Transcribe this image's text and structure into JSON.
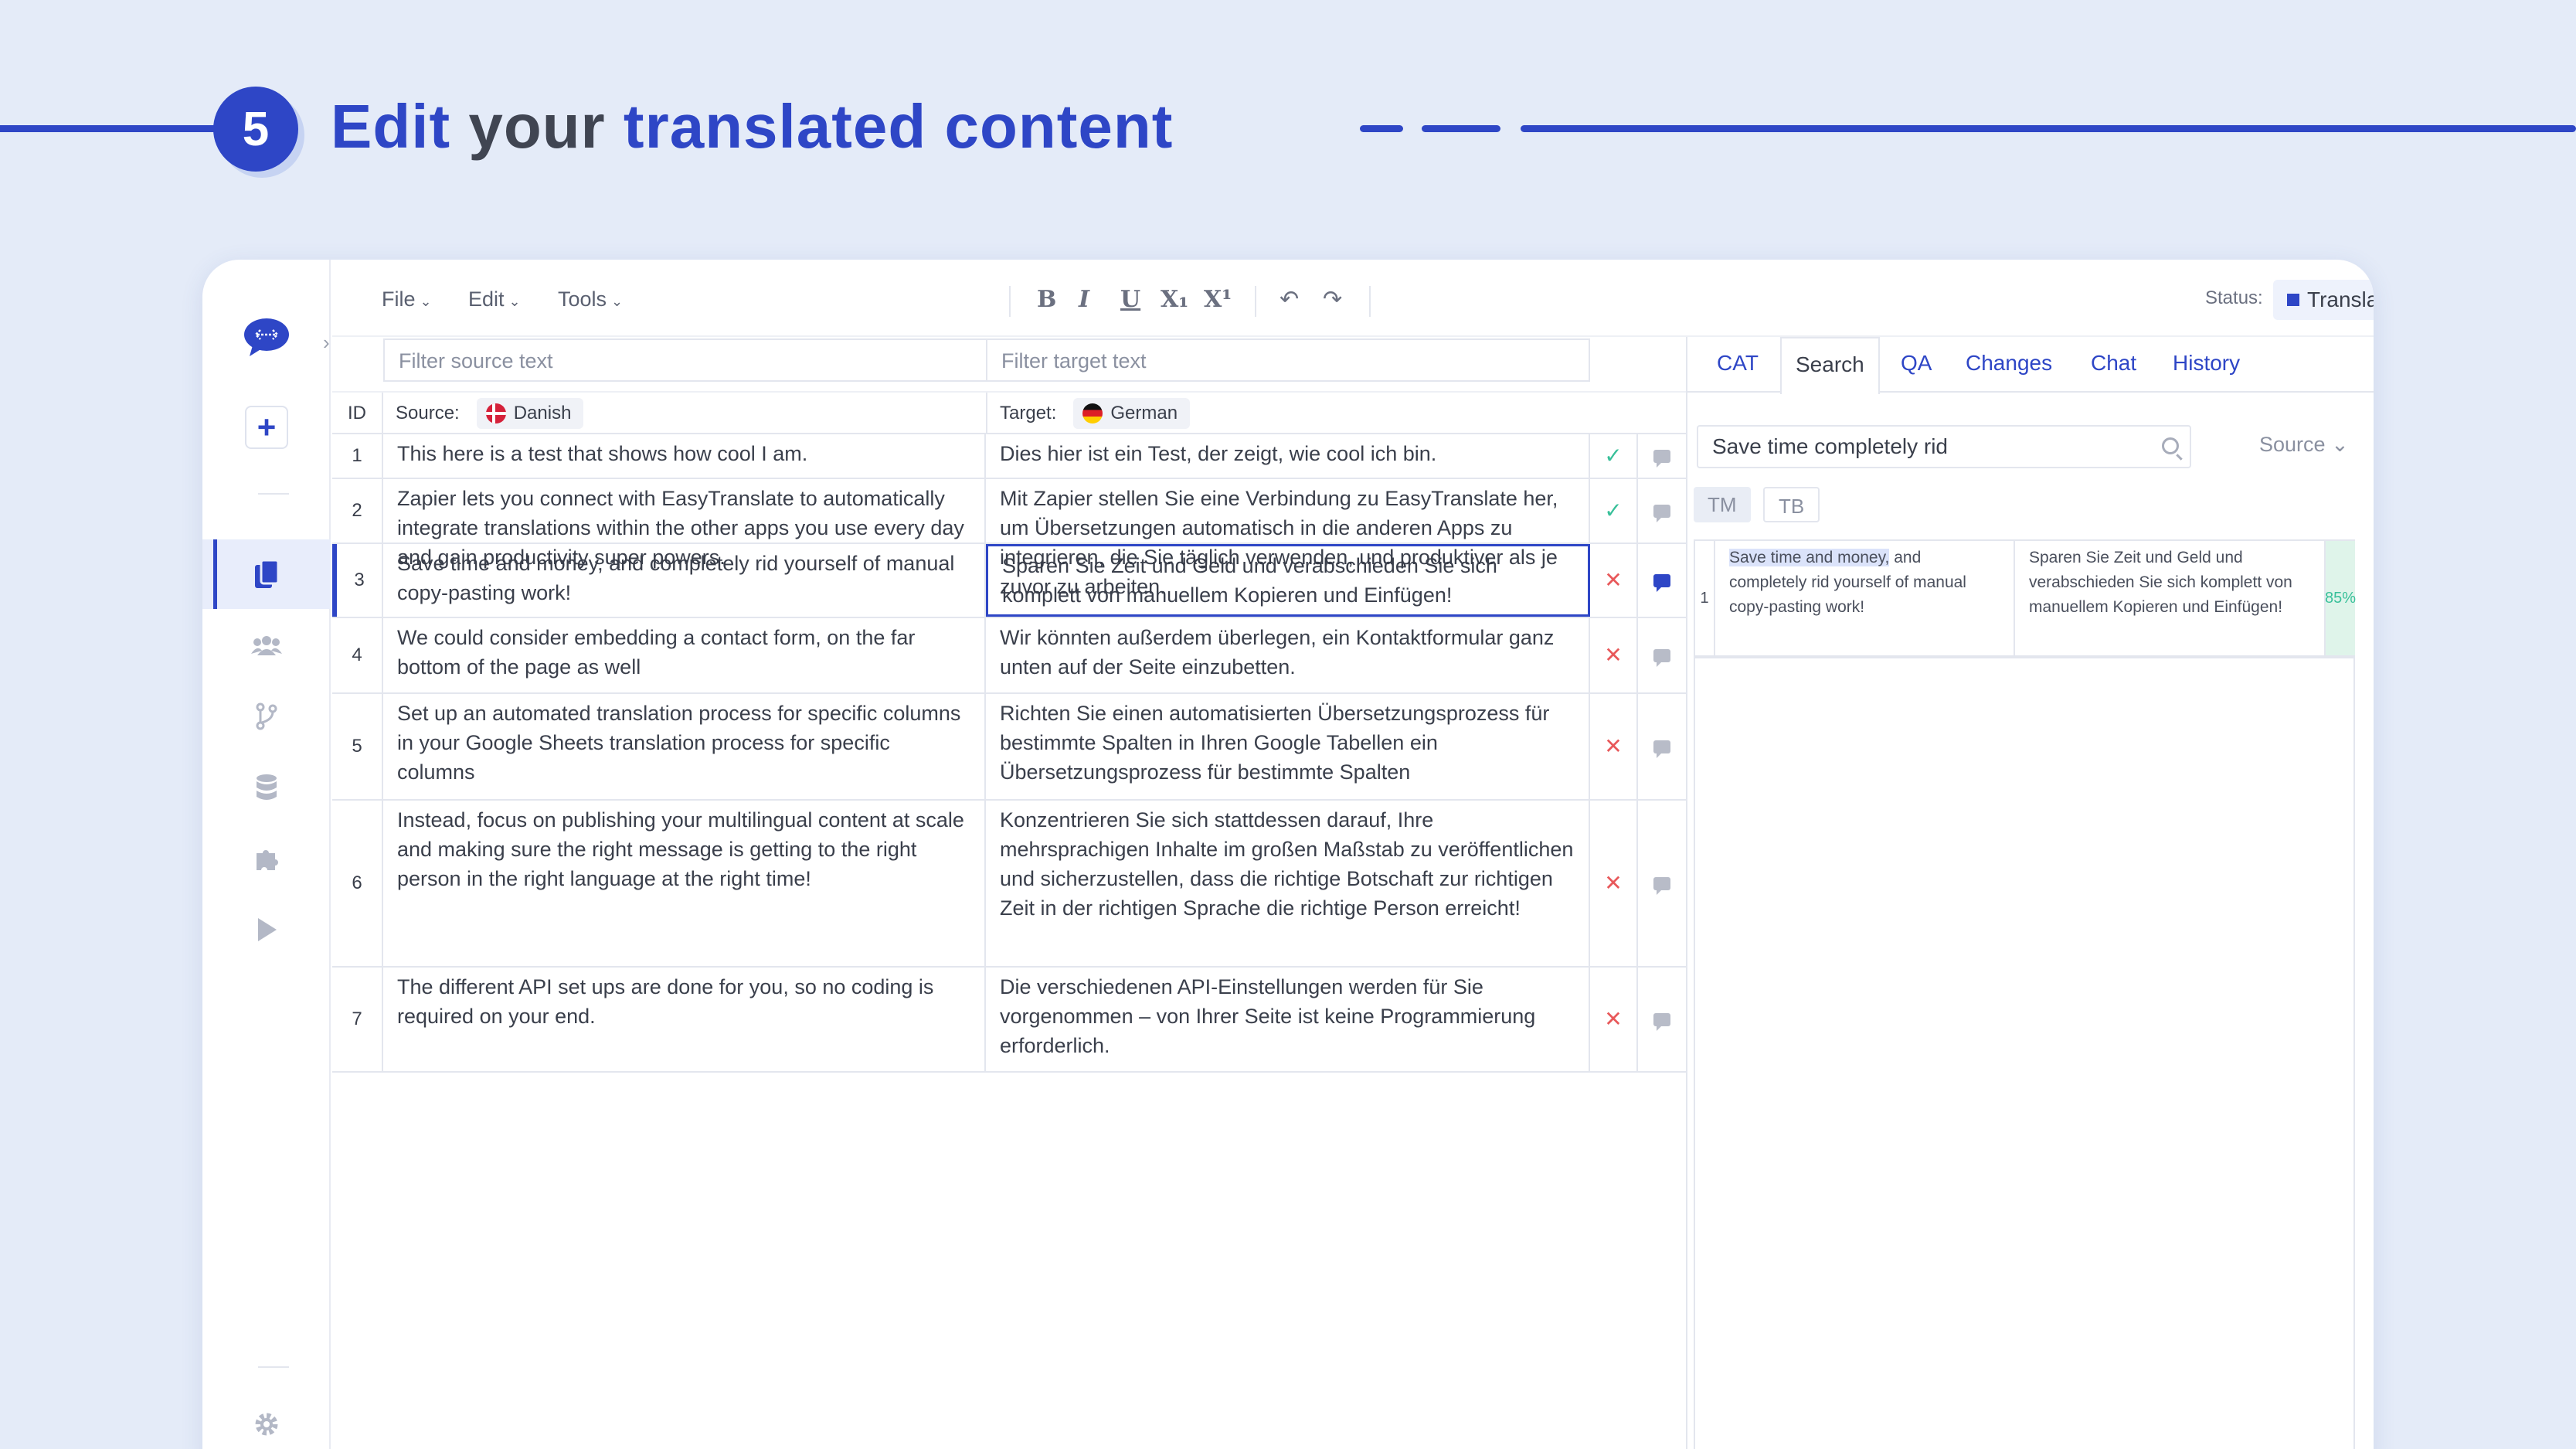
{
  "banner": {
    "step_number": "5",
    "title_part1": "Edit",
    "title_part2": "your",
    "title_part3": "translated content"
  },
  "toolbar": {
    "menus": [
      "File",
      "Edit",
      "Tools"
    ],
    "format_buttons": [
      "B",
      "I",
      "U",
      "X₁",
      "X¹"
    ],
    "undo": "↶",
    "redo": "↷",
    "status_label": "Status:",
    "status_value": "Translated"
  },
  "filters": {
    "source_placeholder": "Filter source text",
    "target_placeholder": "Filter target text"
  },
  "table": {
    "col_id": "ID",
    "col_source": "Source:",
    "source_lang": "Danish",
    "col_target": "Target:",
    "target_lang": "German",
    "rows": [
      {
        "id": "1",
        "source": "This here is a test that shows how cool I am.",
        "target": "Dies hier ist ein Test, der zeigt, wie cool ich bin.",
        "status": "✓",
        "status_type": "ok"
      },
      {
        "id": "2",
        "source": "Zapier lets you connect with EasyTranslate to automatically integrate translations within the other apps you use every day and gain productivity super powers.",
        "target": "Mit Zapier stellen Sie eine Verbindung zu EasyTranslate her, um Übersetzungen automatisch in die anderen Apps zu integrieren, die Sie täglich verwenden, und produktiver als je zuvor zu arbeiten.",
        "status": "✓",
        "status_type": "ok"
      },
      {
        "id": "3",
        "source": "Save time and money, and completely rid yourself of manual copy-pasting work!",
        "target": "Sparen Sie Zeit und Geld und verabschieden Sie sich komplett von manuellem Kopieren und Einfügen!",
        "status": "✕",
        "status_type": "bad"
      },
      {
        "id": "4",
        "source": "We could consider embedding a contact form, on the far bottom of the page as well",
        "target": "Wir könnten außerdem überlegen, ein Kontaktformular ganz unten auf der Seite einzubetten.",
        "status": "✕",
        "status_type": "bad"
      },
      {
        "id": "5",
        "source": "Set up an automated translation process for specific columns in your Google Sheets  translation process for specific columns",
        "target": "Richten Sie einen automatisierten Übersetzungsprozess für bestimmte Spalten in Ihren Google Tabellen ein Übersetzungsprozess für bestimmte Spalten",
        "status": "✕",
        "status_type": "bad"
      },
      {
        "id": "6",
        "source": "Instead, focus on publishing your multilingual content at scale and making sure the right message is getting to the right person in the right language at the right time!",
        "target": "Konzentrieren Sie sich stattdessen darauf, Ihre mehrsprachigen Inhalte im großen Maßstab zu veröffentlichen und sicherzustellen, dass die richtige Botschaft zur richtigen Zeit in der richtigen Sprache die richtige Person erreicht!",
        "status": "✕",
        "status_type": "bad"
      },
      {
        "id": "7",
        "source": "The different API set ups are done for you, so no coding is required on your end.",
        "target": "Die verschiedenen API-Einstellungen werden für Sie vorgenommen – von Ihrer Seite ist keine Programmierung erforderlich.",
        "status": "✕",
        "status_type": "bad"
      }
    ]
  },
  "right_panel": {
    "tabs": [
      "CAT",
      "Search",
      "QA",
      "Changes",
      "Chat",
      "History"
    ],
    "active_tab": "Search",
    "search_value": "Save time completely rid",
    "source_dropdown": "Source",
    "toggle_tm": "TM",
    "toggle_tb": "TB",
    "match": {
      "id": "1",
      "source_highlight": "Save time and money,",
      "source_rest": " and completely rid yourself of manual copy-pasting work!",
      "target": "Sparen Sie Zeit und Geld und verabschieden Sie sich komplett von manuellem Kopieren und Einfügen!",
      "percent": "85%"
    }
  },
  "colors": {
    "accent": "#2e46c6",
    "background": "#e4ebf8",
    "ok": "#39c09a",
    "error": "#e8585a"
  }
}
